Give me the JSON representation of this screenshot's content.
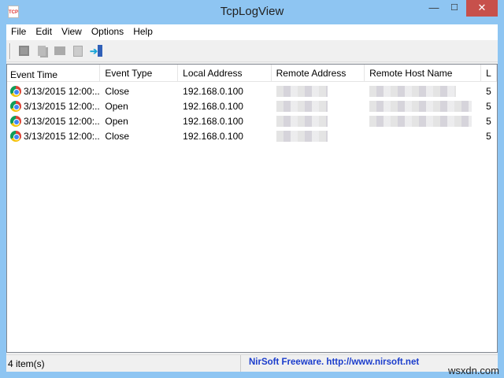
{
  "window": {
    "title": "TcpLogView",
    "icon_text": "TCP",
    "min": "—",
    "max": "☐",
    "close": "✕"
  },
  "menu": [
    "File",
    "Edit",
    "View",
    "Options",
    "Help"
  ],
  "toolbar": [
    "save-icon",
    "copy-icon",
    "properties-icon",
    "find-icon",
    "exit-icon"
  ],
  "columns": [
    "Event Time",
    "Event Type",
    "Local Address",
    "Remote Address",
    "Remote Host Name",
    "L"
  ],
  "rows": [
    {
      "time": "3/13/2015 12:00:...",
      "type": "Close",
      "local": "192.168.0.100",
      "extra": "5"
    },
    {
      "time": "3/13/2015 12:00:...",
      "type": "Open",
      "local": "192.168.0.100",
      "extra": "5"
    },
    {
      "time": "3/13/2015 12:00:...",
      "type": "Open",
      "local": "192.168.0.100",
      "extra": "5"
    },
    {
      "time": "3/13/2015 12:00:...",
      "type": "Close",
      "local": "192.168.0.100",
      "extra": "5"
    }
  ],
  "status": {
    "count": "4 item(s)",
    "credit": "NirSoft Freeware.  http://www.nirsoft.net"
  },
  "watermark": "wsxdn.com"
}
